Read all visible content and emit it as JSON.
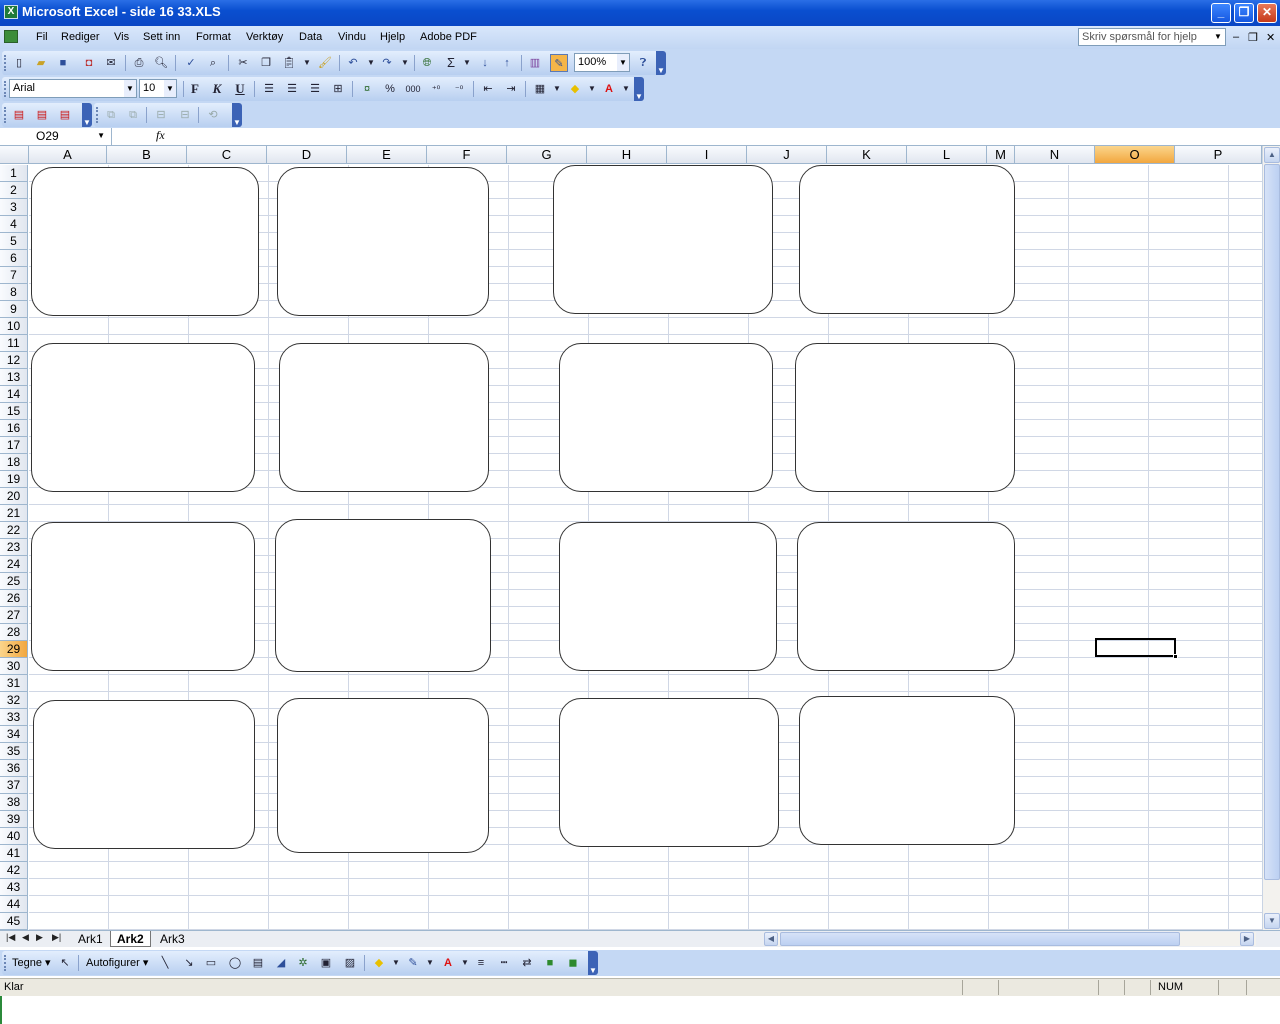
{
  "window": {
    "title": "Microsoft Excel - side 16 33.XLS",
    "app_icon": "X",
    "minimize_glyph": "_",
    "maximize_glyph": "❐",
    "close_glyph": "✕"
  },
  "menubar": {
    "items": [
      "Fil",
      "Rediger",
      "Vis",
      "Sett inn",
      "Format",
      "Verktøy",
      "Data",
      "Vindu",
      "Hjelp",
      "Adobe PDF"
    ],
    "help_placeholder": "Skriv spørsmål for hjelp",
    "mdi_min": "–",
    "mdi_restore": "❐",
    "mdi_close": "✕"
  },
  "standard_toolbar": {
    "zoom": "100%",
    "icons": [
      "new-icon",
      "open-icon",
      "save-icon",
      "permission-icon",
      "email-icon",
      "print-icon",
      "print-preview-icon",
      "spelling-icon",
      "research-icon",
      "cut-icon",
      "copy-icon",
      "paste-icon",
      "format-painter-icon",
      "undo-icon",
      "redo-icon",
      "hyperlink-icon",
      "autosum-icon",
      "sort-ascending-icon",
      "sort-descending-icon",
      "chart-wizard-icon",
      "drawing-icon",
      "help-icon"
    ]
  },
  "formatting_toolbar": {
    "font": "Arial",
    "size": "10",
    "bold": "F",
    "italic": "K",
    "underline": "U",
    "percent": "%",
    "thousands": "000"
  },
  "formula_bar": {
    "name_box": "O29",
    "fx": "fx",
    "value": ""
  },
  "columns": [
    "A",
    "B",
    "C",
    "D",
    "E",
    "F",
    "G",
    "H",
    "I",
    "J",
    "K",
    "L",
    "M",
    "N",
    "O",
    "P"
  ],
  "rows": [
    "1",
    "2",
    "3",
    "4",
    "5",
    "6",
    "7",
    "8",
    "9",
    "10",
    "11",
    "12",
    "13",
    "14",
    "15",
    "16",
    "17",
    "18",
    "19",
    "20",
    "21",
    "22",
    "23",
    "24",
    "25",
    "26",
    "27",
    "28",
    "29",
    "30",
    "31",
    "32",
    "33",
    "34",
    "35",
    "36",
    "37",
    "38",
    "39",
    "40",
    "41",
    "42",
    "43",
    "44",
    "45"
  ],
  "selected_cell": "O29",
  "sheet_tabs": [
    {
      "label": "Ark1",
      "active": false
    },
    {
      "label": "Ark2",
      "active": true
    },
    {
      "label": "Ark3",
      "active": false
    }
  ],
  "drawing_toolbar": {
    "draw_label": "Tegne ▾",
    "autoshapes_label": "Autofigurer ▾"
  },
  "status": {
    "left": "Klar",
    "num": "NUM"
  },
  "colors": {
    "titlebar": "#0a4fd0",
    "selected_header": "#f2a73f",
    "gridline": "#d0d7e5"
  }
}
